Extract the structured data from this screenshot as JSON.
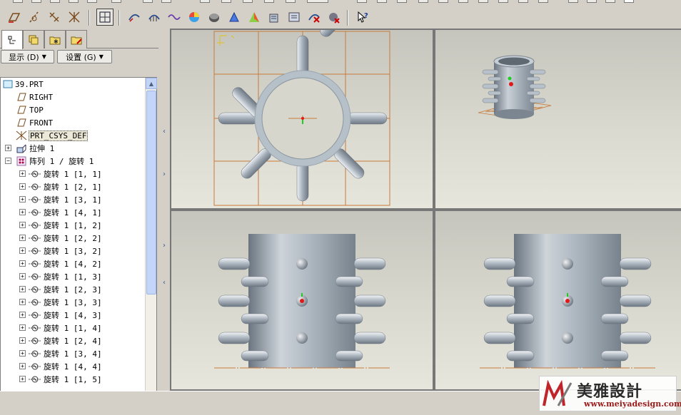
{
  "left_panel": {
    "menus": {
      "display": "显示 (D)",
      "settings": "设置 (G)"
    },
    "tree": {
      "root": "39.PRT",
      "datum_planes": [
        "RIGHT",
        "TOP",
        "FRONT"
      ],
      "csys": "PRT_CSYS_DEF",
      "extrude": "拉伸 1",
      "pattern": "阵列 1 / 旋转 1",
      "pattern_items": [
        "旋转 1 [1, 1]",
        "旋转 1 [2, 1]",
        "旋转 1 [3, 1]",
        "旋转 1 [4, 1]",
        "旋转 1 [1, 2]",
        "旋转 1 [2, 2]",
        "旋转 1 [3, 2]",
        "旋转 1 [4, 2]",
        "旋转 1 [1, 3]",
        "旋转 1 [2, 3]",
        "旋转 1 [3, 3]",
        "旋转 1 [4, 3]",
        "旋转 1 [1, 4]",
        "旋转 1 [2, 4]",
        "旋转 1 [3, 4]",
        "旋转 1 [4, 4]",
        "旋转 1 [1, 5]"
      ]
    }
  },
  "colors": {
    "datum_orange": "#c87a3a",
    "part_body": "#a9b3bd",
    "viewport_bg": "#d7d6cc",
    "axis_green": "#22cc22",
    "axis_red": "#e21818"
  },
  "watermark": {
    "title": "美雅設計",
    "url": "www.meiyadesign.com"
  },
  "icons": {
    "tabs": [
      "model-tree-icon",
      "layer-icon",
      "folder-icon",
      "favorites-icon"
    ],
    "toolbar": [
      "datum-plane-icon",
      "datum-axis-icon",
      "datum-point-icon",
      "datum-csys-icon",
      "view-frame-icon",
      "curvature-icon",
      "analysis-icon",
      "help-icon"
    ]
  }
}
